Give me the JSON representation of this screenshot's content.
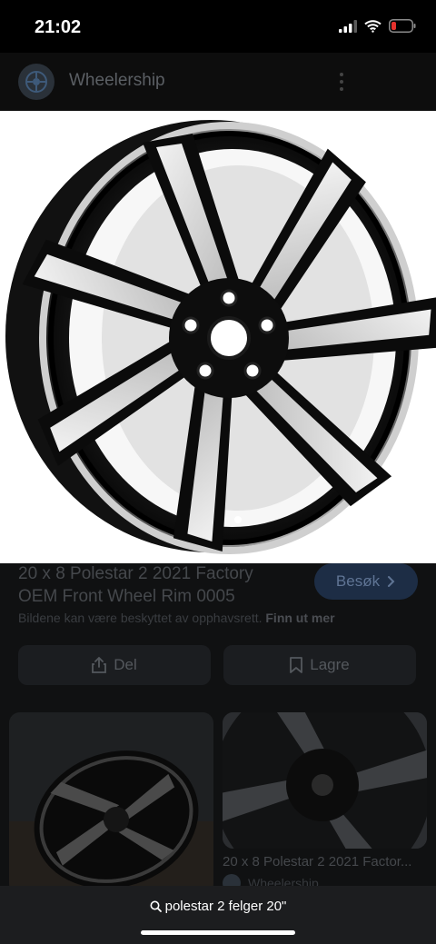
{
  "status_bar": {
    "time": "21:02",
    "battery_color": "#e5312c"
  },
  "header": {
    "site_name": "Wheelership",
    "logo_icon": "wheel-logo-icon",
    "menu_icon": "more-vertical-icon"
  },
  "hero": {
    "image": "black-machined-alloy-wheel-rim"
  },
  "details": {
    "title_line1": "20 x 8 Polestar 2 2021 Factory",
    "title_line2": "OEM Front Wheel Rim 0005",
    "visit_label": "Besøk",
    "visit_icon": "chevron-right-icon",
    "copyright_text": "Bildene kan være beskyttet av opphavsrett.",
    "learn_more": "Finn ut mer"
  },
  "actions": {
    "share_label": "Del",
    "share_icon": "share-icon",
    "save_label": "Lagre",
    "save_icon": "bookmark-icon"
  },
  "related": {
    "right_caption": "20 x 8 Polestar 2 2021 Factor...",
    "right_source": "Wheelership"
  },
  "search": {
    "query": "polestar 2 felger 20\"",
    "icon": "search-icon"
  },
  "colors": {
    "accent_button": "#1d2d45",
    "dim_overlay": "#101112",
    "bottom_bar": "#1c1d1f"
  }
}
